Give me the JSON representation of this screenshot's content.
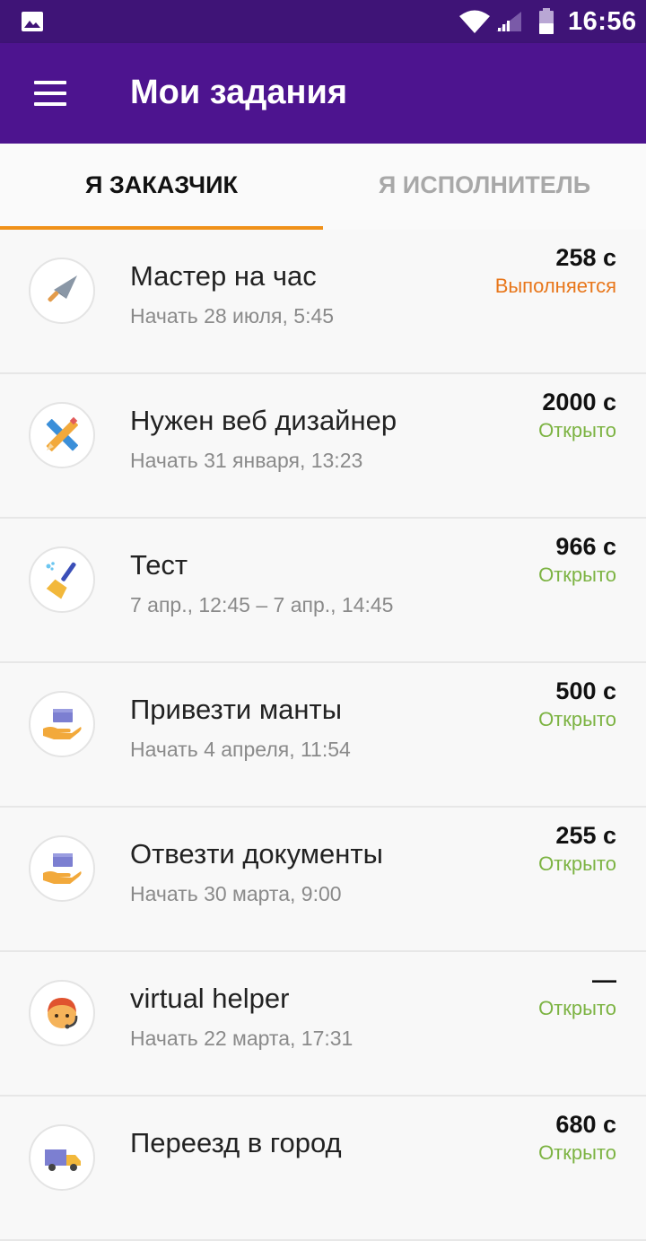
{
  "status_bar": {
    "time": "16:56",
    "icons": [
      "gallery-icon",
      "wifi-icon",
      "signal-icon",
      "battery-icon"
    ]
  },
  "app_bar": {
    "title": "Мои задания",
    "menu_icon": "hamburger-menu-icon"
  },
  "tabs": [
    {
      "label": "Я ЗАКАЗЧИК",
      "active": true
    },
    {
      "label": "Я ИСПОЛНИТЕЛЬ",
      "active": false
    }
  ],
  "colors": {
    "status_bar": "#3f1477",
    "app_bar": "#4d148f",
    "tab_indicator": "#f09119",
    "status_in_progress": "#e8761a",
    "status_open": "#7cb342"
  },
  "tasks": [
    {
      "title": "Мастер на час",
      "subtitle": "Начать 28 июля, 5:45",
      "price": "258 с",
      "status": "Выполняется",
      "icon": "trowel-icon"
    },
    {
      "title": "Нужен веб дизайнер",
      "subtitle": "Начать 31 января, 13:23",
      "price": "2000 с",
      "status": "Открыто",
      "icon": "pencil-ruler-icon"
    },
    {
      "title": "Тест",
      "subtitle": "7 апр., 12:45 – 7 апр., 14:45",
      "price": "966 с",
      "status": "Открыто",
      "icon": "broom-icon"
    },
    {
      "title": "Привезти манты",
      "subtitle": "Начать 4 апреля, 11:54",
      "price": "500 с",
      "status": "Открыто",
      "icon": "box-in-hand-icon"
    },
    {
      "title": "Отвезти документы",
      "subtitle": "Начать 30 марта, 9:00",
      "price": "255 с",
      "status": "Открыто",
      "icon": "box-in-hand-icon"
    },
    {
      "title": "virtual helper",
      "subtitle": "Начать 22 марта, 17:31",
      "price": "—",
      "status": "Открыто",
      "icon": "support-agent-icon"
    },
    {
      "title": "Переезд в город",
      "subtitle": "",
      "price": "680 с",
      "status": "Открыто",
      "icon": "delivery-truck-icon"
    }
  ]
}
